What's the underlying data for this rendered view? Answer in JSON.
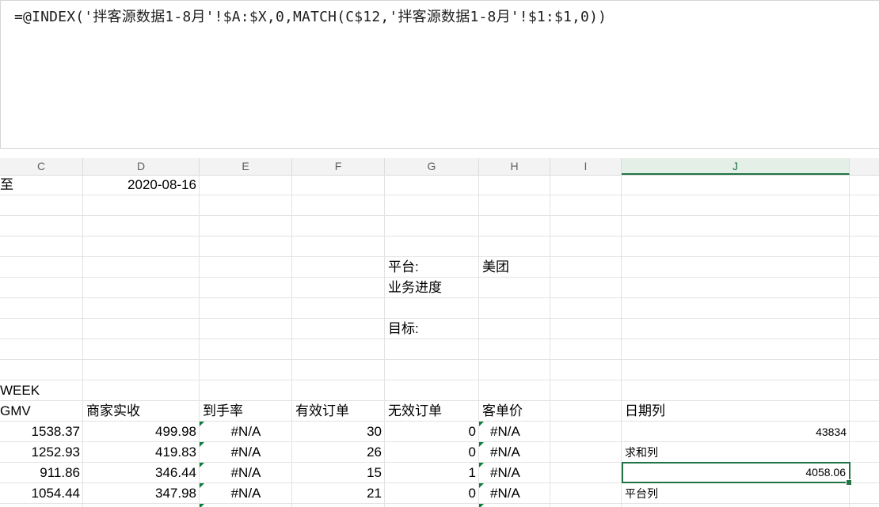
{
  "formula_bar": {
    "formula": "=@INDEX('拌客源数据1-8月'!$A:$X,0,MATCH(C$12,'拌客源数据1-8月'!$1:$1,0))"
  },
  "columns": [
    "C",
    "D",
    "E",
    "F",
    "G",
    "H",
    "I",
    "J"
  ],
  "rows": {
    "r1": {
      "c": "至",
      "d": "2020-08-16"
    },
    "platform": {
      "label": "平台:",
      "value": "美团"
    },
    "progress": {
      "label": "业务进度"
    },
    "target": {
      "label": "目标:"
    },
    "week": {
      "label": "WEEK"
    },
    "headers": {
      "gmv": "GMV",
      "merchant": "商家实收",
      "rate": "到手率",
      "valid": "有效订单",
      "invalid": "无效订单",
      "avg": "客单价",
      "datecol": "日期列"
    },
    "data": [
      {
        "gmv": "1538.37",
        "merchant": "499.98",
        "rate": "#N/A",
        "valid": "30",
        "invalid": "0",
        "avg": "#N/A"
      },
      {
        "gmv": "1252.93",
        "merchant": "419.83",
        "rate": "#N/A",
        "valid": "26",
        "invalid": "0",
        "avg": "#N/A"
      },
      {
        "gmv": "911.86",
        "merchant": "346.44",
        "rate": "#N/A",
        "valid": "15",
        "invalid": "1",
        "avg": "#N/A"
      },
      {
        "gmv": "1054.44",
        "merchant": "347.98",
        "rate": "#N/A",
        "valid": "21",
        "invalid": "0",
        "avg": "#N/A"
      }
    ],
    "side": {
      "date_value": "43834",
      "sum_label": "求和列",
      "sum_value": "4058.06",
      "platform_col_label": "平台列"
    }
  },
  "colors": {
    "accent": "#217346",
    "error_indicator": "#0a7d3b"
  }
}
